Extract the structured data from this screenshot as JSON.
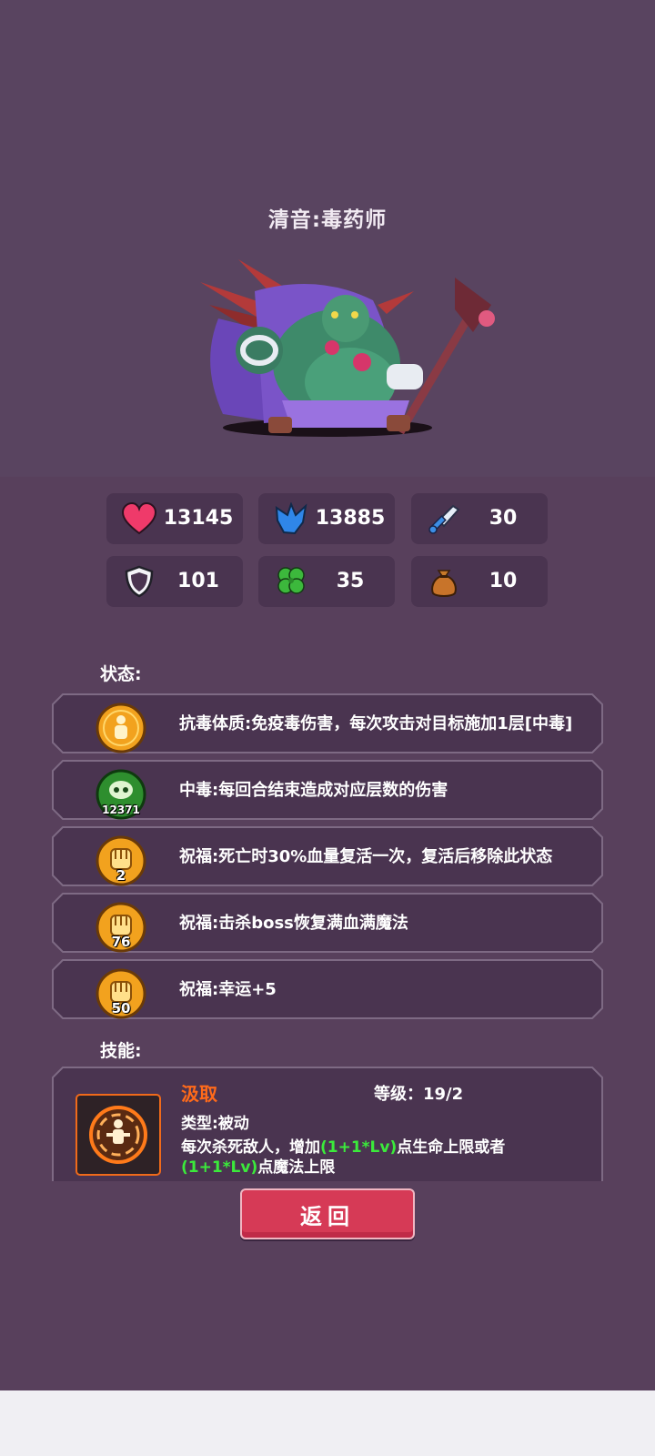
{
  "hero": {
    "title": "清音:毒药师",
    "sprite": "poison-alchemist-monster"
  },
  "stats": [
    {
      "icon": "heart-icon",
      "value": "13145"
    },
    {
      "icon": "mana-crystal-icon",
      "value": "13885"
    },
    {
      "icon": "sword-icon",
      "value": "30"
    },
    {
      "icon": "shield-icon",
      "value": "101"
    },
    {
      "icon": "clover-icon",
      "value": "35"
    },
    {
      "icon": "money-bag-icon",
      "value": "10"
    }
  ],
  "status": {
    "label": "状态:",
    "items": [
      {
        "icon": "immunity-person-icon",
        "count": "",
        "text": "抗毒体质:免疫毒伤害，每次攻击对目标施加1层[中毒]"
      },
      {
        "icon": "poison-skull-icon",
        "count": "12371",
        "text": "中毒:每回合结束造成对应层数的伤害"
      },
      {
        "icon": "blessing-fist-icon",
        "count": "2",
        "text": "祝福:死亡时30%血量复活一次，复活后移除此状态"
      },
      {
        "icon": "blessing-fist-icon",
        "count": "76",
        "text": "祝福:击杀boss恢复满血满魔法"
      },
      {
        "icon": "blessing-fist-icon",
        "count": "50",
        "text": "祝福:幸运+5"
      }
    ]
  },
  "skills": {
    "label": "技能:",
    "items": [
      {
        "icon": "absorb-skill-icon",
        "name": "汲取",
        "level": "等级：19/2",
        "type": "类型:被动",
        "desc_1": "每次杀死敌人，增加",
        "desc_2": "(1+1*Lv)",
        "desc_3": "点生命上限或者",
        "desc_4": "(1+1*Lv)",
        "desc_5": "点魔法上限"
      }
    ]
  },
  "back_button": {
    "label": "返回"
  },
  "colors": {
    "background": "#58405c",
    "panel": "#4a3450",
    "skill_name": "#ff6a1a",
    "highlight": "#3bea3b",
    "button": "#d63a56"
  }
}
